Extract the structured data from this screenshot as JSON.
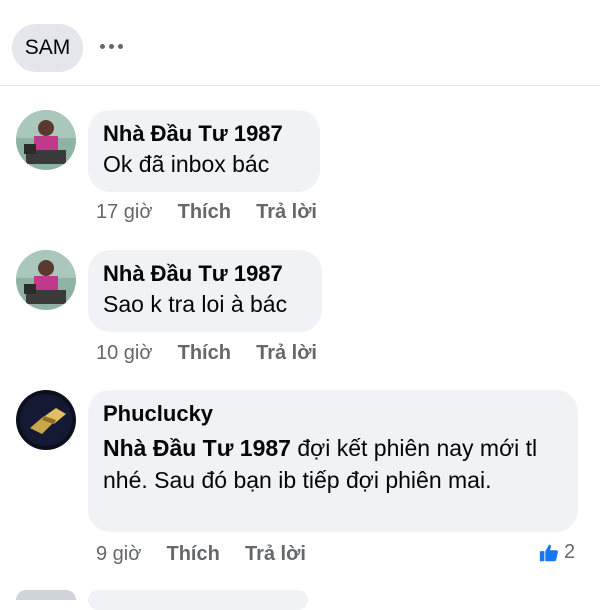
{
  "header": {
    "chip_label": "SAM",
    "more_icon": "more-horizontal-icon"
  },
  "comments": [
    {
      "author": "Nhà Đầu Tư 1987",
      "text": "Ok đã inbox bác",
      "time": "17 giờ",
      "like_label": "Thích",
      "reply_label": "Trả lời"
    },
    {
      "author": "Nhà Đầu Tư 1987",
      "text": "Sao k tra loi à bác",
      "time": "10 giờ",
      "like_label": "Thích",
      "reply_label": "Trả lời"
    },
    {
      "author": "Phuclucky",
      "mention": "Nhà Đầu Tư 1987",
      "text": " đợi kết phiên nay mới tl nhé. Sau đó bạn ib tiếp đợi phiên mai.",
      "time": "9 giờ",
      "like_label": "Thích",
      "reply_label": "Trả lời",
      "reaction_icon": "thumbs-up-icon",
      "reaction_count": "2"
    }
  ],
  "colors": {
    "bubble": "#f0f2f5",
    "meta": "#65676b",
    "like_blue": "#1877f2"
  }
}
